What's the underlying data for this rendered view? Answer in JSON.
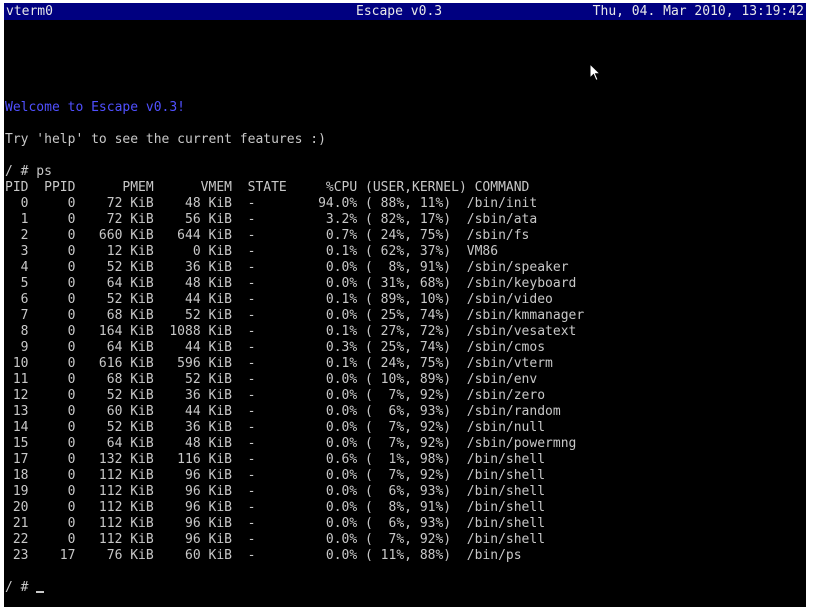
{
  "titlebar": {
    "left": "vterm0",
    "center": "Escape v0.3",
    "right": "Thu, 04. Mar 2010, 13:19:42"
  },
  "welcome": "Welcome to Escape v0.3!",
  "hint": "Try 'help' to see the current features :)",
  "command_line": "/ # ps",
  "ps_header": "PID  PPID      PMEM      VMEM  STATE     %CPU (USER,KERNEL) COMMAND",
  "ps_rows": [
    "  0     0    72 KiB    48 KiB  -        94.0% ( 88%, 11%)  /bin/init",
    "  1     0    72 KiB    56 KiB  -         3.2% ( 82%, 17%)  /sbin/ata",
    "  2     0   660 KiB   644 KiB  -         0.7% ( 24%, 75%)  /sbin/fs",
    "  3     0    12 KiB     0 KiB  -         0.1% ( 62%, 37%)  VM86",
    "  4     0    52 KiB    36 KiB  -         0.0% (  8%, 91%)  /sbin/speaker",
    "  5     0    64 KiB    48 KiB  -         0.0% ( 31%, 68%)  /sbin/keyboard",
    "  6     0    52 KiB    44 KiB  -         0.1% ( 89%, 10%)  /sbin/video",
    "  7     0    68 KiB    52 KiB  -         0.0% ( 25%, 74%)  /sbin/kmmanager",
    "  8     0   164 KiB  1088 KiB  -         0.1% ( 27%, 72%)  /sbin/vesatext",
    "  9     0    64 KiB    44 KiB  -         0.3% ( 25%, 74%)  /sbin/cmos",
    " 10     0   616 KiB   596 KiB  -         0.1% ( 24%, 75%)  /sbin/vterm",
    " 11     0    68 KiB    52 KiB  -         0.0% ( 10%, 89%)  /sbin/env",
    " 12     0    52 KiB    36 KiB  -         0.0% (  7%, 92%)  /sbin/zero",
    " 13     0    60 KiB    44 KiB  -         0.0% (  6%, 93%)  /sbin/random",
    " 14     0    52 KiB    36 KiB  -         0.0% (  7%, 92%)  /sbin/null",
    " 15     0    64 KiB    48 KiB  -         0.0% (  7%, 92%)  /sbin/powermng",
    " 17     0   132 KiB   116 KiB  -         0.6% (  1%, 98%)  /bin/shell",
    " 18     0   112 KiB    96 KiB  -         0.0% (  7%, 92%)  /bin/shell",
    " 19     0   112 KiB    96 KiB  -         0.0% (  6%, 93%)  /bin/shell",
    " 20     0   112 KiB    96 KiB  -         0.0% (  8%, 91%)  /bin/shell",
    " 21     0   112 KiB    96 KiB  -         0.0% (  6%, 93%)  /bin/shell",
    " 22     0   112 KiB    96 KiB  -         0.0% (  7%, 92%)  /bin/shell",
    " 23    17    76 KiB    60 KiB  -         0.0% ( 11%, 88%)  /bin/ps"
  ],
  "prompt": "/ # ",
  "colors": {
    "titlebar_bg": "#000080",
    "welcome_text": "#5050ff",
    "terminal_text": "#c8c8c8",
    "terminal_bg": "#000000"
  },
  "icons": {
    "mouse_pointer": "arrow-pointer-icon"
  }
}
